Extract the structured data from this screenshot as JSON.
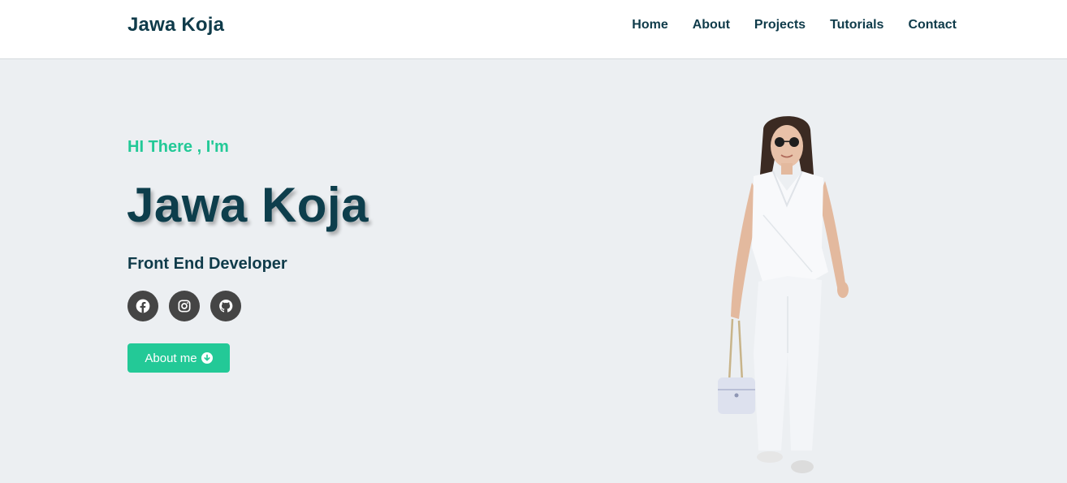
{
  "header": {
    "brand": "Jawa Koja",
    "nav": [
      "Home",
      "About",
      "Projects",
      "Tutorials",
      "Contact"
    ]
  },
  "hero": {
    "greeting": "HI There , I'm",
    "name": "Jawa Koja",
    "role": "Front End Developer",
    "socials": [
      {
        "icon": "facebook-icon"
      },
      {
        "icon": "instagram-icon"
      },
      {
        "icon": "github-icon"
      }
    ],
    "cta_label": "About me",
    "cta_icon": "arrow-down-circle-icon"
  },
  "colors": {
    "accent": "#23c997",
    "text_dark": "#0f3b4a",
    "background": "#eceff2",
    "social_bg": "#454545"
  }
}
